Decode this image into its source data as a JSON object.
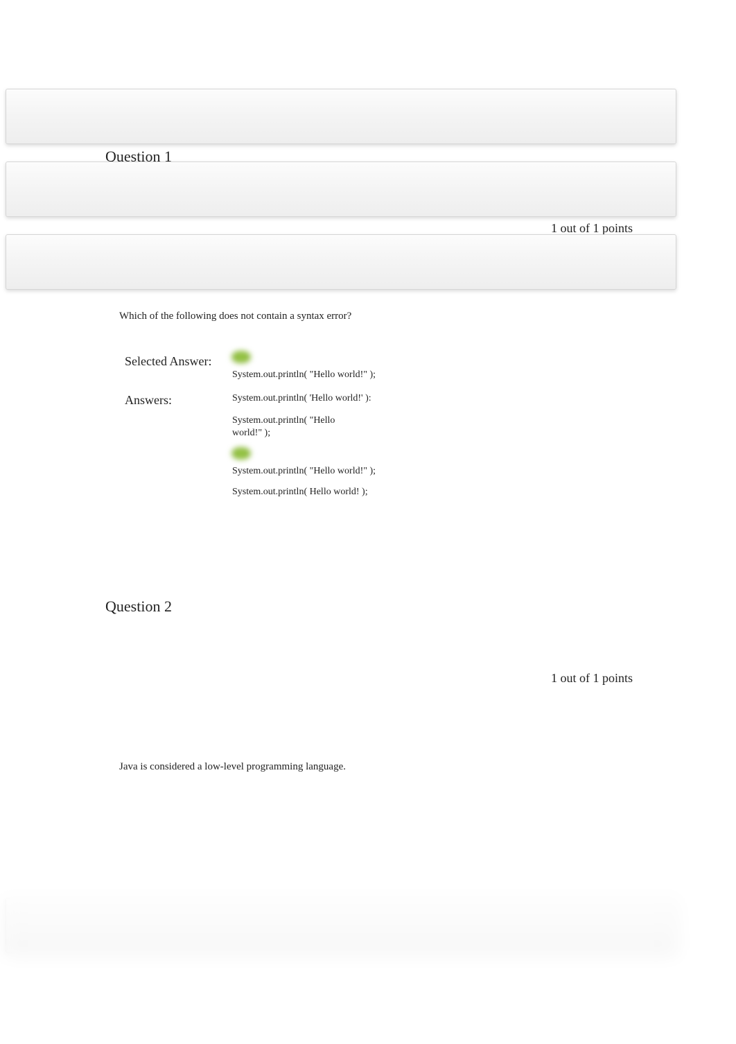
{
  "bullet": "",
  "q1": {
    "title": "Question 1",
    "points": "1 out of 1 points",
    "text": "Which of the following does not contain a syntax error?",
    "selected_label": "Selected Answer:",
    "answers_label": "Answers:",
    "selected_answer": "System.out.println( \"Hello world!\" );",
    "answers": [
      "System.out.println( 'Hello world!' ):",
      "System.out.println( \"Hello world!\" );",
      "System.out.println( \"Hello world!\" );",
      "System.out.println( Hello world! );"
    ]
  },
  "q2": {
    "title": "Question 2",
    "points": "1 out of 1 points",
    "text": "Java is considered a low-level programming language."
  }
}
